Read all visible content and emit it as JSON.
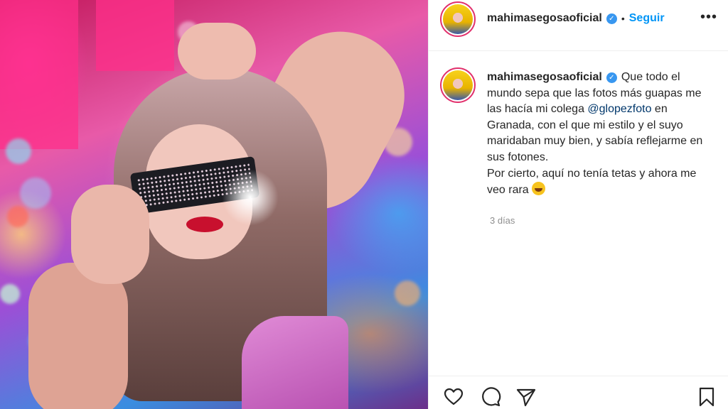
{
  "post": {
    "username": "mahimasegosaoficial",
    "follow_label": "Seguir",
    "separator": "•",
    "more_label": "•••",
    "caption": {
      "text_1": "Que todo el mundo sepa que las fotos más guapas me las hacía mi colega ",
      "mention": "@glopezfoto",
      "text_2": " en Granada, con el que mi estilo y el suyo maridaban muy bien, y sabía reflejarme en sus fotones.",
      "text_3": "Por cierto, aquí no tenía tetas y ahora me veo rara "
    },
    "timestamp": "3 días"
  },
  "icons": {
    "like": "heart-icon",
    "comment": "comment-icon",
    "share": "paper-plane-icon",
    "save": "bookmark-icon",
    "verified": "verified-badge-icon",
    "emoji": "laughing-emoji-icon"
  },
  "colors": {
    "link": "#0095f6",
    "mention": "#00376b",
    "verified": "#3897f0",
    "muted": "#8e8e8e"
  }
}
